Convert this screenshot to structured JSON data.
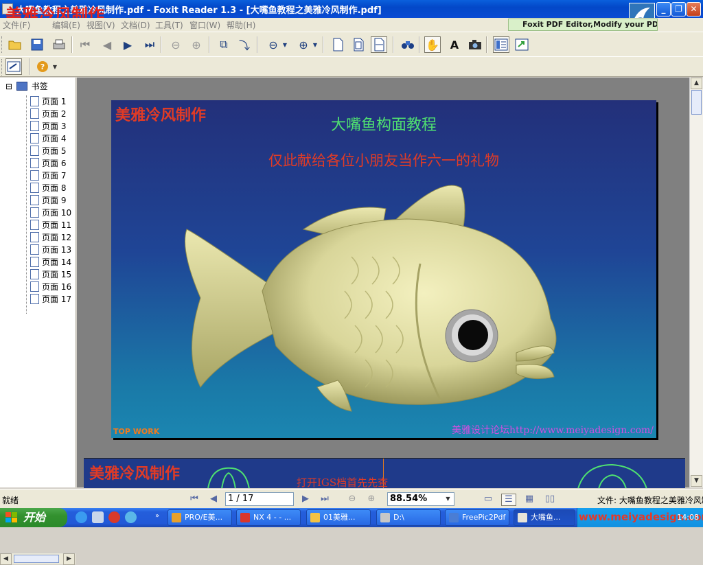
{
  "window": {
    "title": "大嘴鱼教程之美雅冷风制作.pdf - Foxit Reader 1.3 - [大嘴鱼教程之美雅冷风制作.pdf]",
    "watermark": "美雅冷风制作",
    "buttons": {
      "minimize": "_",
      "restore": "❐",
      "close": "✕"
    }
  },
  "menu": {
    "items": [
      "文件(F)",
      "编辑(E)",
      "视图(V)",
      "文档(D)",
      "工具(T)",
      "窗口(W)",
      "帮助(H)"
    ],
    "ad": "Foxit PDF Editor,Modify your PDF"
  },
  "bookmarks": {
    "root": "书签",
    "expander": "⊟",
    "pages": [
      "页面 1",
      "页面 2",
      "页面 3",
      "页面 4",
      "页面 5",
      "页面 6",
      "页面 7",
      "页面 8",
      "页面 9",
      "页面 10",
      "页面 11",
      "页面 12",
      "页面 13",
      "页面 14",
      "页面 15",
      "页面 16",
      "页面 17"
    ]
  },
  "document": {
    "page1": {
      "watermark": "美雅冷风制作",
      "title": "大嘴鱼构面教程",
      "subtitle": "仅此献给各位小朋友当作六一的礼物",
      "corner_label": "TOP WORK",
      "forum": "美雅设计论坛http://www.meiyadesign.com/"
    },
    "page2": {
      "watermark": "美雅冷风制作",
      "text": "打开IGS档首先先查"
    }
  },
  "statusbar": {
    "ready": "就绪",
    "page": "1 / 17",
    "zoom": "88.54%",
    "file": "文件: 大嘴鱼教程之美雅冷风制作.pdf"
  },
  "taskbar": {
    "start": "开始",
    "tasks": [
      "PRO/E美...",
      "NX 4 - - ...",
      "01美雅...",
      "D:\\",
      "FreePic2Pdf",
      "大嘴鱼..."
    ],
    "tray_url": "www.meiyadesign.com",
    "clock": "14:08"
  },
  "colors": {
    "titlebar": "#0348c8",
    "page_bg_top": "#23307a",
    "page_bg_bottom": "#1b86b1",
    "title_green": "#4fe070",
    "watermark_red": "#e03b26",
    "fish_body": "#d9d69a"
  }
}
